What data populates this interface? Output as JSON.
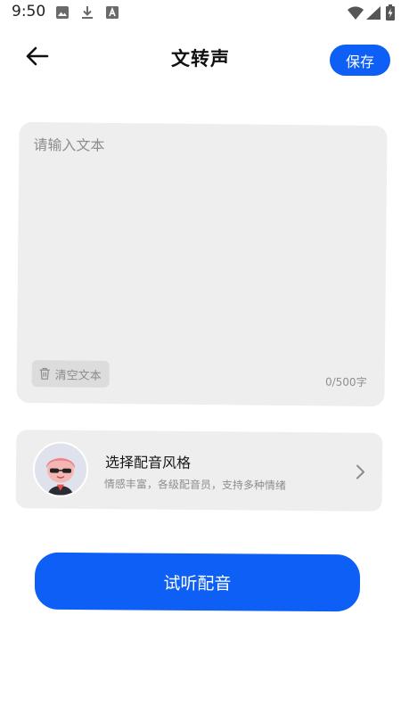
{
  "status_bar": {
    "time": "9:50",
    "left_icons": [
      "image-icon",
      "download-icon",
      "text-a-icon"
    ],
    "right_icons": [
      "wifi-icon",
      "signal-icon",
      "battery-charging-icon"
    ]
  },
  "header": {
    "back_icon": "arrow-left-icon",
    "title": "文转声",
    "save_label": "保存"
  },
  "editor": {
    "value": "",
    "placeholder": "请输入文本",
    "clear_label": "清空文本",
    "clear_icon": "trash-icon",
    "char_count": "0/500字"
  },
  "voice_style": {
    "title": "选择配音风格",
    "subtitle": "情感丰富，各级配音员，支持多种情绪",
    "avatar": "cartoon-avatar",
    "chevron_icon": "chevron-right-icon"
  },
  "actions": {
    "preview_label": "试听配音"
  },
  "colors": {
    "accent": "#0d5ff5",
    "card_bg": "#eeeeee",
    "muted_text": "#8e8e8e"
  }
}
